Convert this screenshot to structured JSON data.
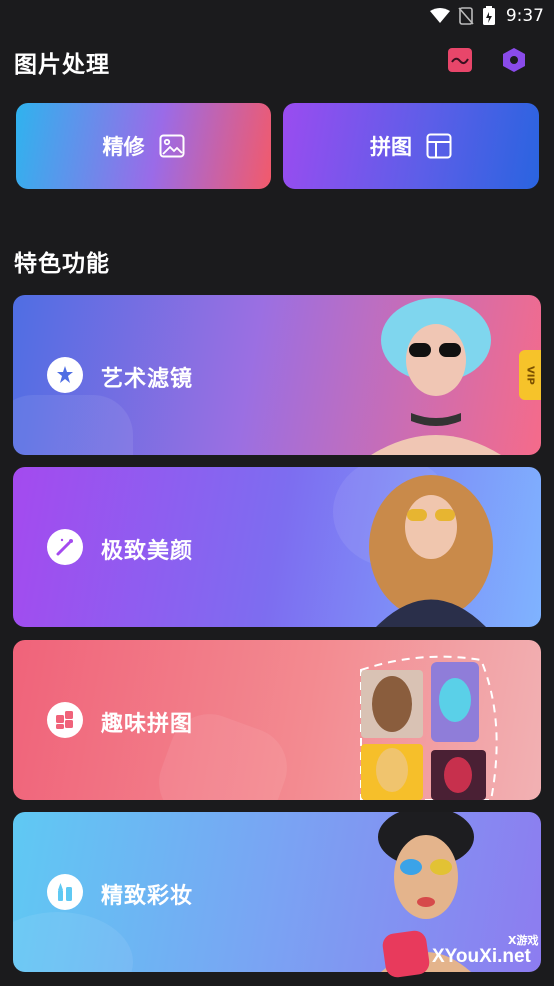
{
  "status_bar": {
    "time": "9:37"
  },
  "header": {
    "title": "图片处理"
  },
  "actions": [
    {
      "label": "精修"
    },
    {
      "label": "拼图"
    }
  ],
  "section": {
    "title": "特色功能"
  },
  "features": [
    {
      "label": "艺术滤镜",
      "badge": "VIP"
    },
    {
      "label": "极致美颜"
    },
    {
      "label": "趣味拼图"
    },
    {
      "label": "精致彩妆"
    }
  ],
  "watermark": {
    "small": "X游戏",
    "text": "XYouXi.net"
  },
  "colors": {
    "background": "#1b1b1d",
    "vip": "#f6c32a",
    "header_icon_1": "#e8466a",
    "header_icon_2": "#8a4bea"
  }
}
